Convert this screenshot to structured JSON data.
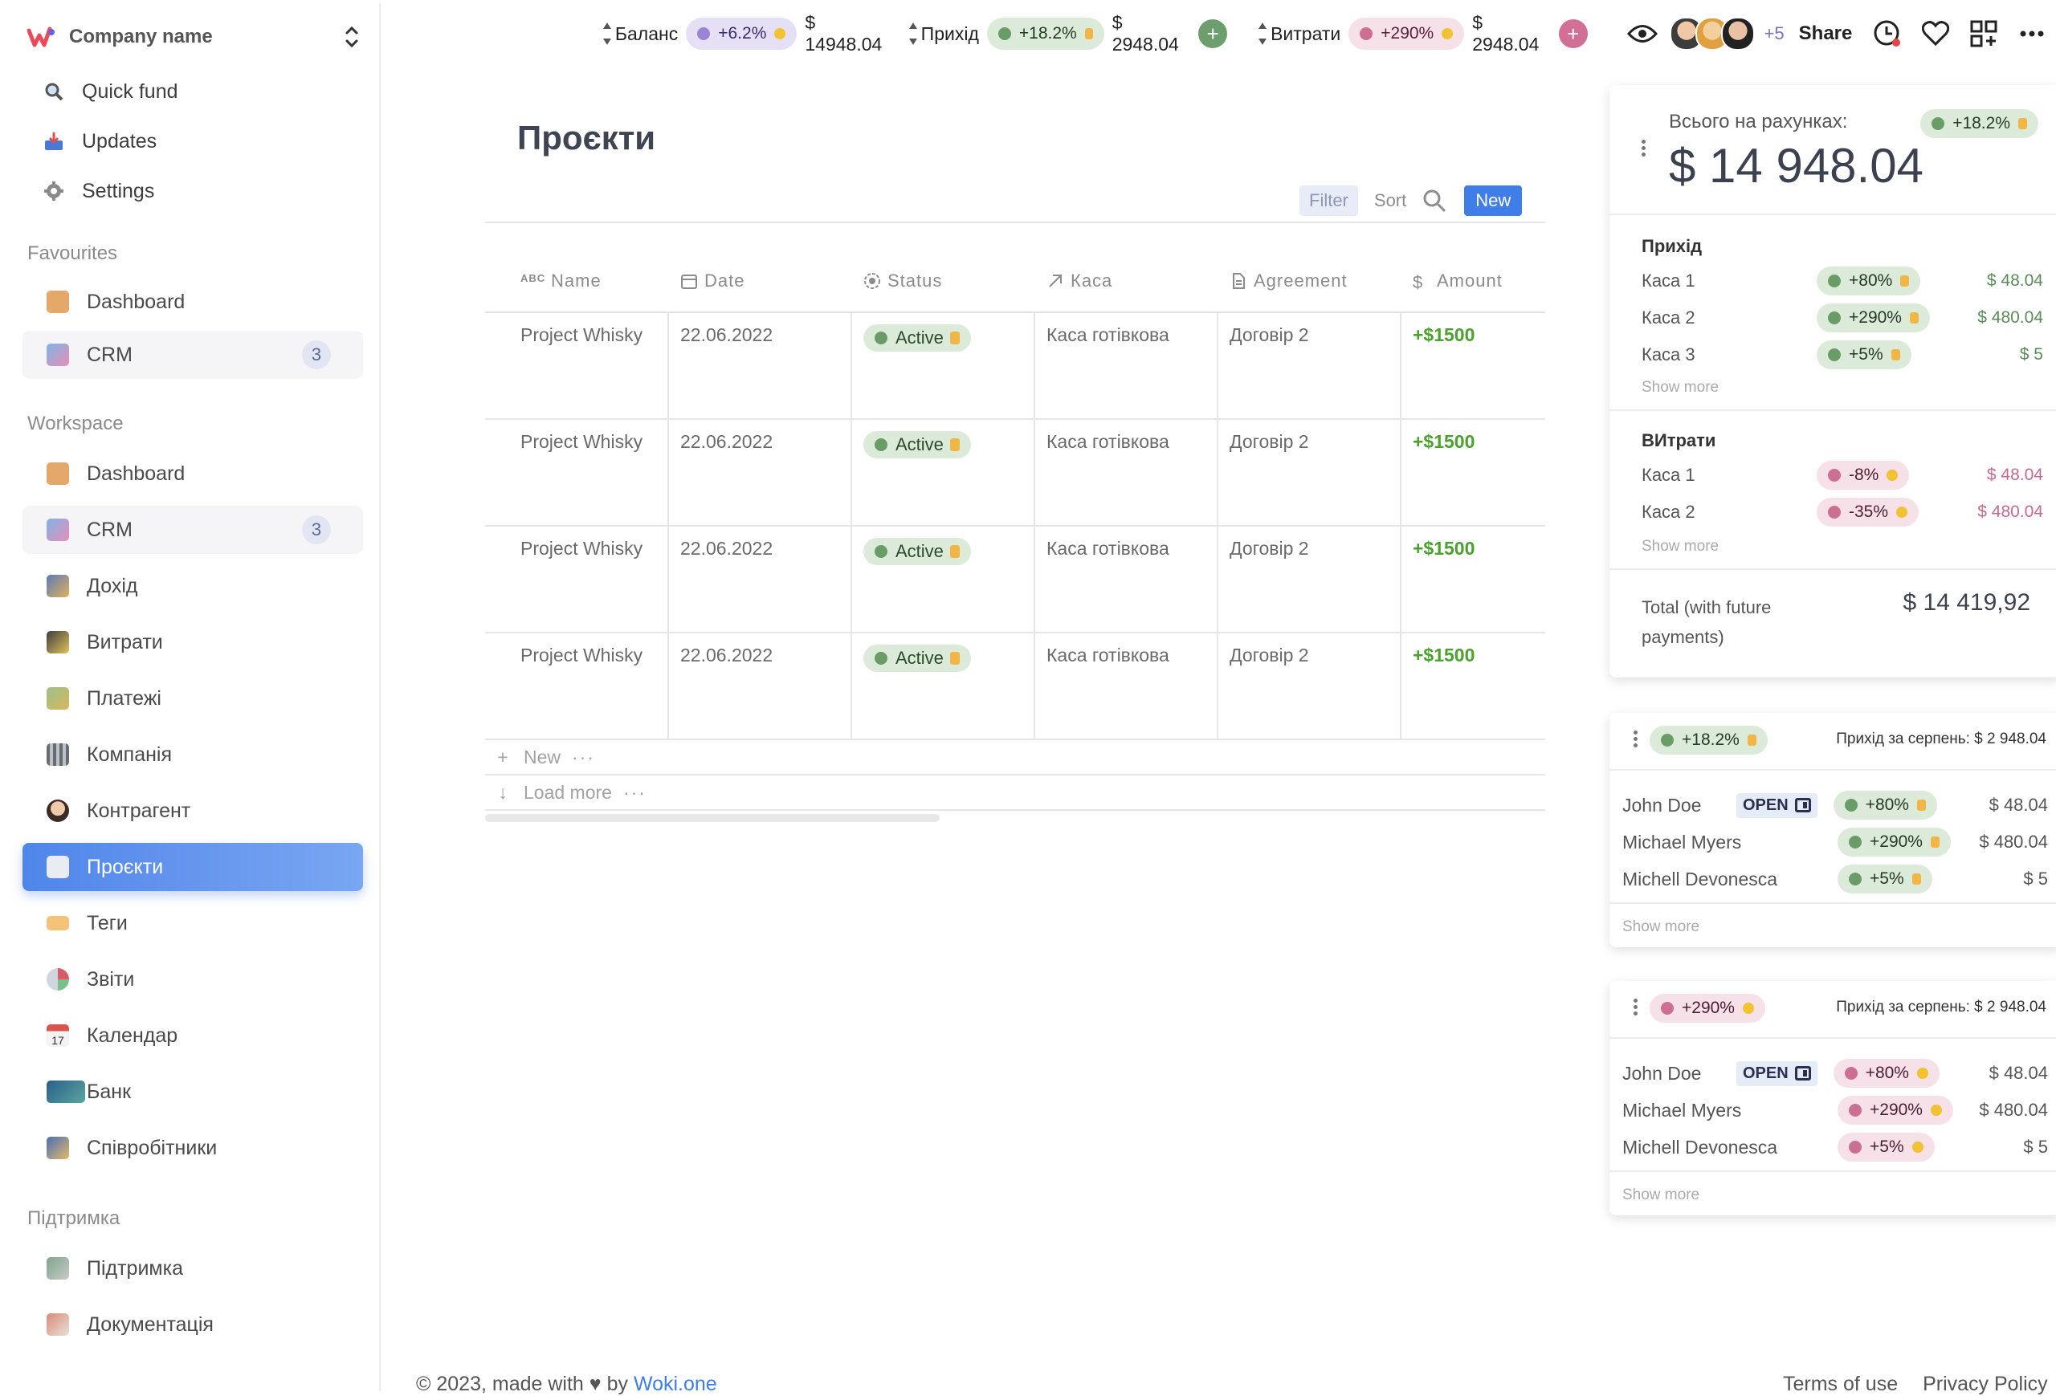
{
  "sidebar": {
    "company_name": "Company name",
    "top_links": [
      {
        "label": "Quick fund",
        "icon": "search-icon"
      },
      {
        "label": "Updates",
        "icon": "inbox-icon"
      },
      {
        "label": "Settings",
        "icon": "gear-icon"
      }
    ],
    "favourites_title": "Favourites",
    "favourites": [
      {
        "label": "Dashboard",
        "icon": "box-icon"
      },
      {
        "label": "CRM",
        "icon": "chart-icon",
        "badge": "3"
      }
    ],
    "workspace_title": "Workspace",
    "workspace": [
      {
        "label": "Dashboard",
        "icon": "box-icon"
      },
      {
        "label": "CRM",
        "icon": "chart-icon",
        "badge": "3"
      },
      {
        "label": "Дохід",
        "icon": "money-hand-icon"
      },
      {
        "label": "Витрати",
        "icon": "wallet-icon"
      },
      {
        "label": "Платежі",
        "icon": "cash-icon"
      },
      {
        "label": "Компанія",
        "icon": "office-icon"
      },
      {
        "label": "Контрагент",
        "icon": "person-icon"
      },
      {
        "label": "Проєкти",
        "icon": "document-icon",
        "active": true
      },
      {
        "label": "Теги",
        "icon": "tag-icon"
      },
      {
        "label": "Звіти",
        "icon": "pie-icon"
      },
      {
        "label": "Календар",
        "icon": "calendar-icon",
        "day": "17"
      },
      {
        "label": "Банк",
        "icon": "bank-icon"
      },
      {
        "label": "Співробітники",
        "icon": "people-icon"
      }
    ],
    "support_title": "Підтримка",
    "support": [
      {
        "label": "Підтримка",
        "icon": "support-icon"
      },
      {
        "label": "Документація",
        "icon": "book-icon"
      }
    ]
  },
  "topbar": {
    "balance": {
      "label": "Баланс",
      "change": "+6.2%",
      "value": "$ 14948.04"
    },
    "income": {
      "label": "Прихід",
      "change": "+18.2%",
      "value": "$ 2948.04",
      "add": "+"
    },
    "expenses": {
      "label": "Витрати",
      "change": "+290%",
      "value": "$ 2948.04",
      "add": "+"
    },
    "more_users": "+5",
    "share": "Share",
    "icons": [
      "eye-icon",
      "clock-icon",
      "heart-icon",
      "apps-icon",
      "more-icon"
    ],
    "colors": {
      "purple": "#e6e0f6",
      "green": "#dcebd9",
      "pink": "#f7e1e9"
    }
  },
  "main": {
    "title": "Проєкти",
    "filter": "Filter",
    "sort": "Sort",
    "new_button": "New",
    "columns": [
      {
        "label": "Name",
        "icon": "abc-icon"
      },
      {
        "label": "Date",
        "icon": "calendar-icon"
      },
      {
        "label": "Status",
        "icon": "status-icon"
      },
      {
        "label": "Каса",
        "icon": "arrow-icon"
      },
      {
        "label": "Agreement",
        "icon": "file-icon"
      },
      {
        "label": "Amount",
        "icon": "dollar-icon"
      }
    ],
    "rows": [
      {
        "name": "Project Whisky",
        "date": "22.06.2022",
        "status": "Active",
        "kasa": "Каса готівкова",
        "agreement": "Договір 2",
        "amount": "+$1500"
      },
      {
        "name": "Project Whisky",
        "date": "22.06.2022",
        "status": "Active",
        "kasa": "Каса готівкова",
        "agreement": "Договір 2",
        "amount": "+$1500"
      },
      {
        "name": "Project Whisky",
        "date": "22.06.2022",
        "status": "Active",
        "kasa": "Каса готівкова",
        "agreement": "Договір 2",
        "amount": "+$1500"
      },
      {
        "name": "Project Whisky",
        "date": "22.06.2022",
        "status": "Active",
        "kasa": "Каса готівкова",
        "agreement": "Договір 2",
        "amount": "+$1500"
      }
    ],
    "new_row": "New",
    "load_more": "Load more"
  },
  "footer": {
    "copyright": "© 2023, made with",
    "by": "by",
    "brand": "Woki.one",
    "terms": "Terms of use",
    "privacy": "Privacy Policy"
  },
  "summary_card": {
    "label": "Всього на рахунках:",
    "change": "+18.2%",
    "total": "$ 14 948.04",
    "income_title": "Прихід",
    "income": [
      {
        "name": "Каса 1",
        "change": "+80%",
        "value": "$ 48.04"
      },
      {
        "name": "Каса 2",
        "change": "+290%",
        "value": "$ 480.04"
      },
      {
        "name": "Каса 3",
        "change": "+5%",
        "value": "$ 5"
      }
    ],
    "expenses_title": "ВИтрати",
    "expenses": [
      {
        "name": "Каса 1",
        "change": "-8%",
        "value": "$ 48.04"
      },
      {
        "name": "Каса 2",
        "change": "-35%",
        "value": "$ 480.04"
      }
    ],
    "show_more": "Show more",
    "future_label": "Total (with future payments)",
    "future_value": "$ 14 419,92"
  },
  "income_card": {
    "change": "+18.2%",
    "title": "Прихід за серпень: $ 2 948.04",
    "open": "OPEN",
    "people": [
      {
        "name": "John Doe",
        "change": "+80%",
        "value": "$ 48.04",
        "open": true
      },
      {
        "name": "Michael Myers",
        "change": "+290%",
        "value": "$ 480.04"
      },
      {
        "name": "Michell Devonesca",
        "change": "+5%",
        "value": "$ 5"
      }
    ],
    "show_more": "Show more"
  },
  "expense_card": {
    "change": "+290%",
    "title": "Прихід за серпень: $ 2 948.04",
    "open": "OPEN",
    "people": [
      {
        "name": "John Doe",
        "change": "+80%",
        "value": "$ 48.04",
        "open": true
      },
      {
        "name": "Michael Myers",
        "change": "+290%",
        "value": "$ 480.04"
      },
      {
        "name": "Michell Devonesca",
        "change": "+5%",
        "value": "$ 5"
      }
    ],
    "show_more": "Show more"
  }
}
